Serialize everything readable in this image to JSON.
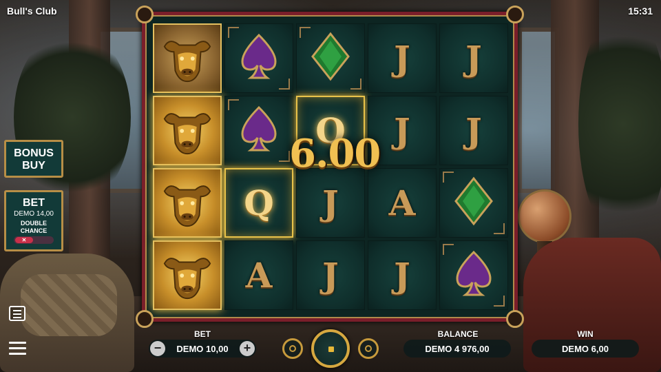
{
  "header": {
    "title": "Bull's Club",
    "clock": "15:31"
  },
  "reels": {
    "rows": [
      [
        {
          "symbol": "bull",
          "state": "dim"
        },
        {
          "symbol": "spade",
          "state": "normal"
        },
        {
          "symbol": "diamond",
          "state": "normal"
        },
        {
          "symbol": "J",
          "state": "normal"
        },
        {
          "symbol": "J",
          "state": "normal"
        }
      ],
      [
        {
          "symbol": "bull",
          "state": "win"
        },
        {
          "symbol": "spade",
          "state": "normal"
        },
        {
          "symbol": "Q",
          "state": "win"
        },
        {
          "symbol": "J",
          "state": "normal"
        },
        {
          "symbol": "J",
          "state": "normal"
        }
      ],
      [
        {
          "symbol": "bull",
          "state": "win"
        },
        {
          "symbol": "Q",
          "state": "win"
        },
        {
          "symbol": "J",
          "state": "normal"
        },
        {
          "symbol": "A",
          "state": "normal"
        },
        {
          "symbol": "diamond",
          "state": "normal"
        }
      ],
      [
        {
          "symbol": "bull",
          "state": "win"
        },
        {
          "symbol": "A",
          "state": "normal"
        },
        {
          "symbol": "J",
          "state": "normal"
        },
        {
          "symbol": "J",
          "state": "normal"
        },
        {
          "symbol": "spade",
          "state": "normal"
        }
      ]
    ],
    "win_overlay": "6.00"
  },
  "left_panel": {
    "bonus_buy_line1": "BONUS",
    "bonus_buy_line2": "BUY",
    "bet_title": "BET",
    "bet_value": "DEMO 14,00",
    "double_chance_line1": "DOUBLE",
    "double_chance_line2": "CHANCE",
    "double_chance_toggle": "✕"
  },
  "bottom_bar": {
    "bet_label": "BET",
    "bet_value": "DEMO 10,00",
    "bet_minus": "−",
    "bet_plus": "+",
    "balance_label": "BALANCE",
    "balance_value": "DEMO 4 976,00",
    "win_label": "WIN",
    "win_value": "DEMO 6,00"
  },
  "colors": {
    "frame": "#7a1e2a",
    "gold": "#e8c24a",
    "cell": "#0f2e2b",
    "spade": "#6a2a8a",
    "diamond": "#1f7a2e"
  },
  "icons": [
    "paytable-icon",
    "menu-icon",
    "coin-stack-icon",
    "stop-icon",
    "autoplay-icon",
    "minus-icon",
    "plus-icon"
  ]
}
